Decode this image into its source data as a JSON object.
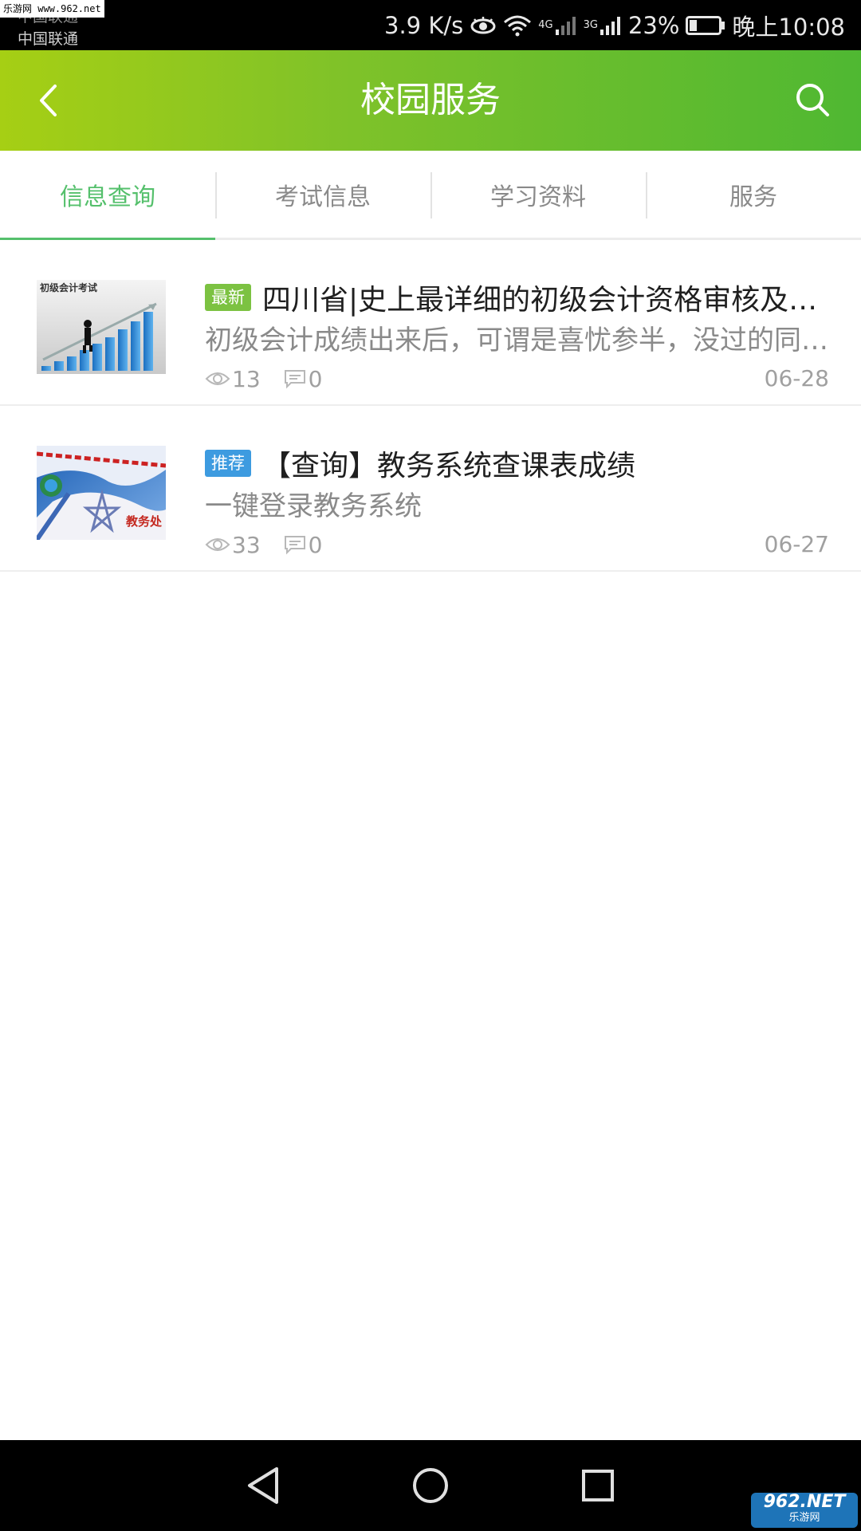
{
  "watermark": {
    "top": "乐游网 www.962.net",
    "bottom_brand": "962.NET",
    "bottom_sub": "乐游网"
  },
  "status_bar": {
    "carrier_1": "中国联通",
    "carrier_2": "中国联通",
    "net_speed": "3.9 K/s",
    "signal_1_label": "4G",
    "signal_2_label": "3G",
    "battery": "23%",
    "time": "晚上10:08"
  },
  "header": {
    "title": "校园服务",
    "back_icon": "chevron-left-icon",
    "search_icon": "search-icon"
  },
  "tabs": [
    {
      "label": "信息查询",
      "active": true
    },
    {
      "label": "考试信息",
      "active": false
    },
    {
      "label": "学习资料",
      "active": false
    },
    {
      "label": "服务",
      "active": false
    }
  ],
  "articles": [
    {
      "badge": "最新",
      "badge_color": "#7cc242",
      "title": "四川省|史上最详细的初级会计资格审核及证书领取时间",
      "summary": "初级会计成绩出来后，可谓是喜忧参半，没过的同学继续努力",
      "views": "13",
      "comments": "0",
      "date": "06-28",
      "thumb_caption": "初级会计考试"
    },
    {
      "badge": "推荐",
      "badge_color": "#3d9be0",
      "title": "【查询】教务系统查课表成绩",
      "summary": "一键登录教务系统",
      "views": "33",
      "comments": "0",
      "date": "06-27",
      "thumb_caption": "教务处"
    }
  ],
  "colors": {
    "accent_green": "#55c06c",
    "header_gradient_start": "#a6cf14",
    "header_gradient_end": "#4fb832"
  }
}
